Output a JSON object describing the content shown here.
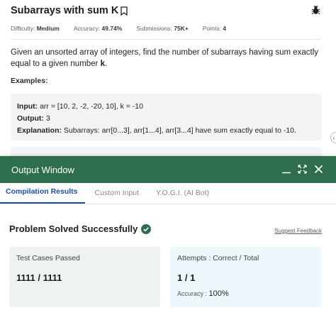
{
  "problem": {
    "title": "Subarrays with sum K",
    "meta": {
      "difficulty_label": "Difficulty:",
      "difficulty_value": "Medium",
      "accuracy_label": "Accuracy:",
      "accuracy_value": "49.74%",
      "submissions_label": "Submissions:",
      "submissions_value": "75K+",
      "points_label": "Points:",
      "points_value": "4"
    },
    "description": "Given an unsorted array of integers, find the number of subarrays having sum exactly equal to a given number ",
    "description_k": "k",
    "description_end": ".",
    "examples_heading": "Examples:",
    "example1": {
      "input_label": "Input:",
      "input_value": " arr = [10, 2, -2, -20, 10], k = -10",
      "output_label": "Output:",
      "output_value": " 3",
      "explanation_label": "Explanation:",
      "explanation_value": " Subarrays: arr[0...3], arr[1...4], arr[3...4] have sum exactly equal to -10."
    }
  },
  "output_window": {
    "title": "Output Window",
    "tabs": [
      {
        "label": "Compilation Results",
        "active": true
      },
      {
        "label": "Custom Input",
        "active": false
      },
      {
        "label": "Y.O.G.I. (AI Bot)",
        "active": false
      }
    ],
    "status": "Problem Solved Successfully",
    "feedback_link": "Suggest Feedback",
    "test_cases": {
      "label": "Test Cases Passed",
      "value": "1111 / 1111"
    },
    "attempts": {
      "label": "Attempts : Correct / Total",
      "value": "1 / 1",
      "accuracy_label": "Accuracy :",
      "accuracy_value": "100%"
    }
  },
  "colors": {
    "header_green": "#2f6e4d",
    "active_tab_blue": "#1d4e9e",
    "success_green": "#2f6e4d"
  },
  "icons": [
    "bookmark-icon",
    "bug-icon",
    "minimize-icon",
    "expand-icon",
    "close-icon",
    "check-circle-icon"
  ]
}
